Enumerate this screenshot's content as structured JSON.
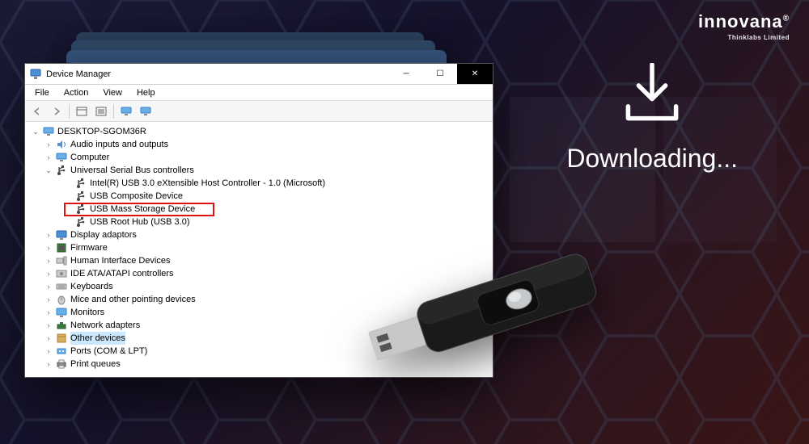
{
  "logo": {
    "brand": "innovana",
    "reg": "®",
    "sub": "Thinklabs Limited"
  },
  "download_text": "Downloading...",
  "window": {
    "title": "Device Manager",
    "menu": {
      "file": "File",
      "action": "Action",
      "view": "View",
      "help": "Help"
    },
    "tree": {
      "root": "DESKTOP-SGOM36R",
      "audio": "Audio inputs and outputs",
      "computer": "Computer",
      "usb_ctrl": "Universal Serial Bus controllers",
      "usb_children": {
        "intel": "Intel(R) USB 3.0 eXtensible Host Controller - 1.0 (Microsoft)",
        "composite": "USB Composite Device",
        "mass_storage": "USB Mass Storage Device",
        "root_hub": "USB Root Hub (USB 3.0)"
      },
      "display": "Display adaptors",
      "firmware": "Firmware",
      "hid": "Human Interface Devices",
      "ide": "IDE ATA/ATAPI controllers",
      "keyboards": "Keyboards",
      "mice": "Mice and other pointing devices",
      "monitors": "Monitors",
      "network": "Network adapters",
      "other": "Other devices",
      "ports": "Ports (COM & LPT)",
      "print": "Print queues"
    }
  }
}
